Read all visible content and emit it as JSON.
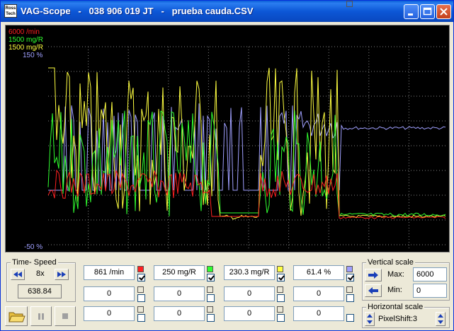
{
  "window": {
    "title": "VAG-Scope   -   038 906 019 JT   -   prueba cauda.CSV",
    "icon_text": "Ross Tech"
  },
  "scope": {
    "legend": [
      {
        "label": "6000 /min",
        "color": "#ff2020"
      },
      {
        "label": "1500 mg/R",
        "color": "#30ff30"
      },
      {
        "label": "1500 mg/R",
        "color": "#ffff40"
      },
      {
        "label": "150 %",
        "color": "#a0a0ff"
      }
    ],
    "bottom_label": "-50 %",
    "bottom_label_color": "#a0a0ff"
  },
  "time_speed": {
    "title": "Time- Speed",
    "speed_value": "8x",
    "position_value": "638.84"
  },
  "channels": [
    {
      "value": "861 /min",
      "color": "#ff2020",
      "checked": true
    },
    {
      "value": "250 mg/R",
      "color": "#30ff30",
      "checked": true
    },
    {
      "value": "230.3 mg/R",
      "color": "#ffff40",
      "checked": true
    },
    {
      "value": "61.4 %",
      "color": "#a0a0ff",
      "checked": true
    }
  ],
  "channels_row2": [
    "0",
    "0",
    "0",
    "0"
  ],
  "channels_row3": [
    "0",
    "0",
    "0",
    "0"
  ],
  "vertical_scale": {
    "title": "Vertical scale",
    "max_label": "Max:",
    "max_value": "6000",
    "min_label": "Min:",
    "min_value": "0"
  },
  "horizontal_scale": {
    "title": "Horizontal scale",
    "value": "PixelShift:3"
  },
  "icons": [
    "app-logo-icon",
    "minimize-icon",
    "maximize-icon",
    "close-icon",
    "rewind-icon",
    "fast-forward-icon",
    "right-arrow-icon",
    "left-arrow-icon",
    "folder-icon",
    "pause-icon",
    "stop-icon",
    "spin-arrows-icon"
  ]
}
